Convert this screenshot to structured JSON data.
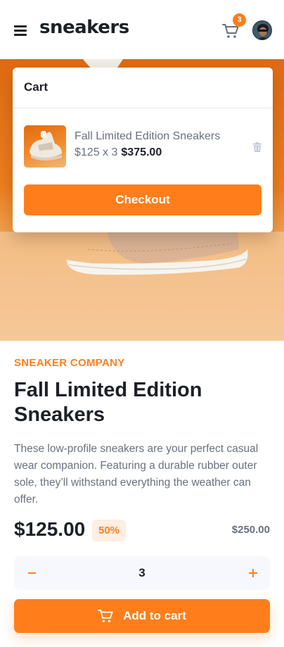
{
  "header": {
    "logo": "sneakers",
    "cart_count": "3",
    "icons": {
      "menu": "menu-icon",
      "cart": "cart-icon",
      "avatar": "avatar"
    }
  },
  "cart_popup": {
    "title": "Cart",
    "item": {
      "name": "Fall Limited Edition Sneakers",
      "unit_price": "$125 x 3",
      "total": "$375.00"
    },
    "checkout_label": "Checkout"
  },
  "product": {
    "company": "SNEAKER COMPANY",
    "title": "Fall Limited Edition Sneakers",
    "description": "These low-profile sneakers are your perfect casual wear companion. Featuring a durable rubber outer sole, they’ll withstand everything the weather can offer.",
    "price": "$125.00",
    "discount": "50%",
    "original_price": "$250.00",
    "quantity": "3",
    "add_to_cart_label": "Add to cart"
  },
  "colors": {
    "accent": "#ff7e1b",
    "accent_light": "#ffeee2",
    "text_dark": "#1d2026",
    "text_gray": "#69707d"
  }
}
